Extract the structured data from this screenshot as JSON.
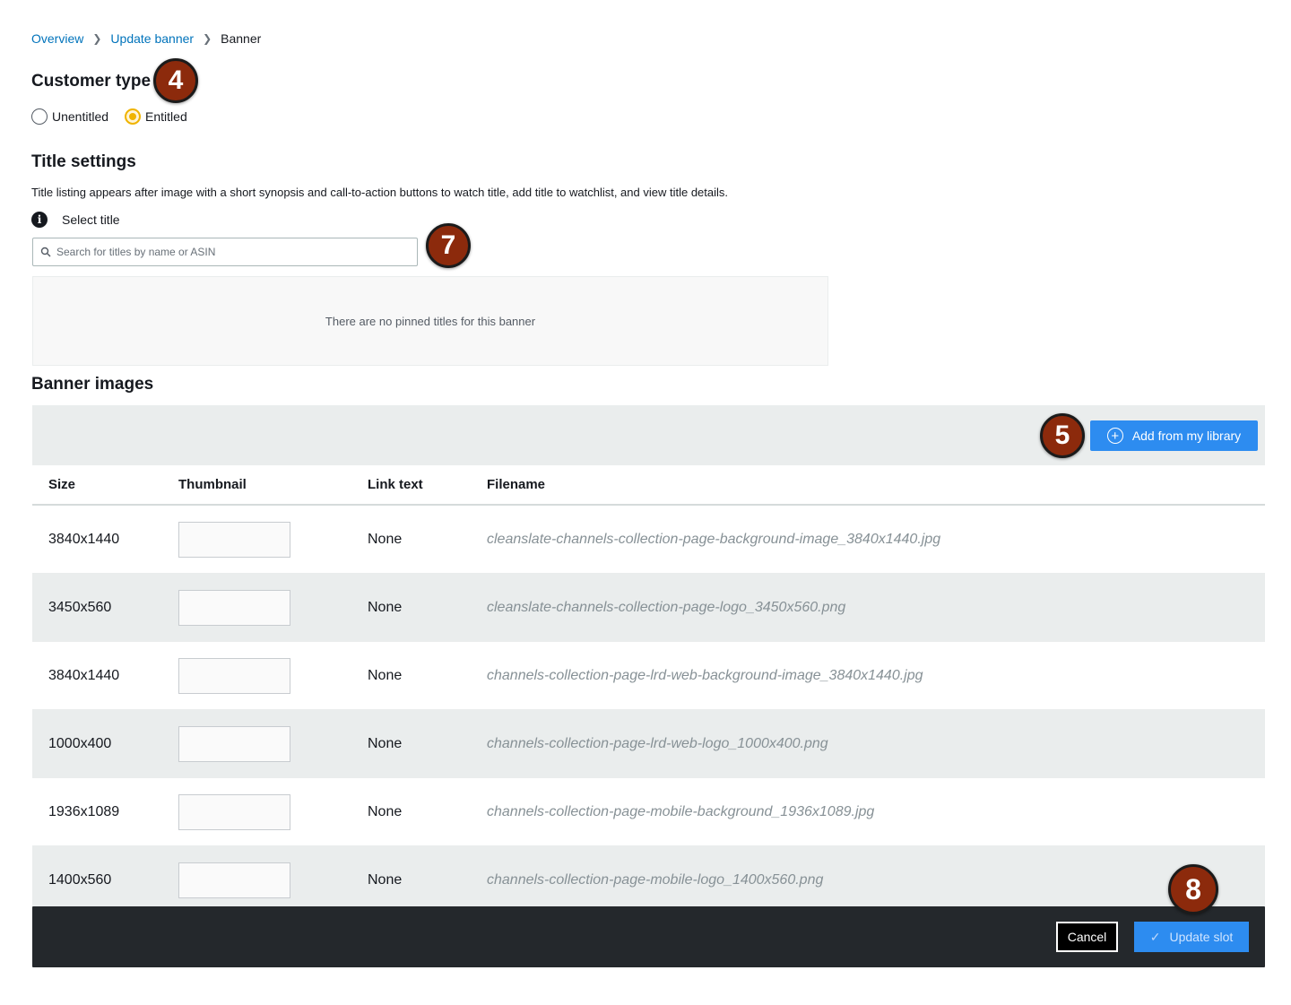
{
  "breadcrumb": {
    "items": [
      "Overview",
      "Update banner"
    ],
    "current": "Banner"
  },
  "customer_type": {
    "heading": "Customer type",
    "options": [
      {
        "label": "Unentitled",
        "selected": false
      },
      {
        "label": "Entitled",
        "selected": true
      }
    ]
  },
  "title_settings": {
    "heading": "Title settings",
    "description": "Title listing appears after image with a short synopsis and call-to-action buttons to watch title, add title to watchlist, and view title details.",
    "select_label": "Select title",
    "search_placeholder": "Search for titles by name or ASIN",
    "empty_message": "There are no pinned titles for this banner"
  },
  "banner_images": {
    "heading": "Banner images",
    "add_button": "Add from my library",
    "columns": [
      "Size",
      "Thumbnail",
      "Link text",
      "Filename"
    ],
    "rows": [
      {
        "size": "3840x1440",
        "link_text": "None",
        "filename": "cleanslate-channels-collection-page-background-image_3840x1440.jpg"
      },
      {
        "size": "3450x560",
        "link_text": "None",
        "filename": "cleanslate-channels-collection-page-logo_3450x560.png"
      },
      {
        "size": "3840x1440",
        "link_text": "None",
        "filename": "channels-collection-page-lrd-web-background-image_3840x1440.jpg"
      },
      {
        "size": "1000x400",
        "link_text": "None",
        "filename": "channels-collection-page-lrd-web-logo_1000x400.png"
      },
      {
        "size": "1936x1089",
        "link_text": "None",
        "filename": "channels-collection-page-mobile-background_1936x1089.jpg"
      },
      {
        "size": "1400x560",
        "link_text": "None",
        "filename": "channels-collection-page-mobile-logo_1400x560.png"
      }
    ]
  },
  "footer": {
    "cancel": "Cancel",
    "update": "Update slot"
  },
  "badges": {
    "customer_type": "4",
    "add_library": "5",
    "search": "7",
    "update": "8"
  },
  "colors": {
    "link": "#0073bb",
    "primary_button": "#2d8cf0",
    "badge": "#8c2a0c",
    "radio_selected": "#f0b400",
    "footer_bg": "#24282c"
  }
}
